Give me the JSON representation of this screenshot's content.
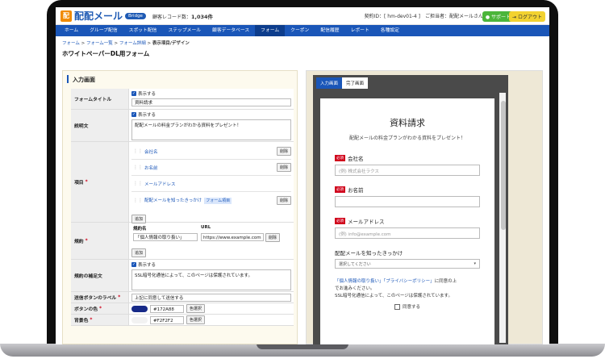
{
  "header": {
    "logo_mark": "配",
    "logo_text": "配配メール",
    "badge": "Bridge",
    "record_label": "顧客レコード数：",
    "record_count": "1,034件",
    "account": "契約ID：[ hm-dev01-4 ]　ご担当者：配配メールさん",
    "support": "サポート",
    "logout": "ログアウト"
  },
  "nav": [
    "ホーム",
    "グループ配信",
    "スポット配信",
    "ステップメール",
    "顧客データベース",
    "フォーム",
    "クーポン",
    "配信履歴",
    "レポート",
    "各種設定"
  ],
  "breadcrumb": {
    "a": "フォーム",
    "b": "フォーム一覧",
    "c": "フォーム詳細",
    "d": "表示項目/デザイン",
    "sep": " > "
  },
  "page_title": "ホワイトペーパーDL用フォーム",
  "left": {
    "section_title": "入力画面",
    "show_label": "表示する",
    "form_title_label": "フォームタイトル",
    "form_title_value": "資料請求",
    "desc_label": "説明文",
    "desc_value": "配配メールの料金プランがわかる資料をプレゼント！",
    "items_label": "項目",
    "items": [
      {
        "label": "会社名",
        "del": "削除"
      },
      {
        "label": "お名前",
        "del": "削除"
      },
      {
        "label": "メールアドレス",
        "del": ""
      },
      {
        "label": "配配メールを知ったきっかけ",
        "tag": "フォーム項目",
        "del": "削除"
      }
    ],
    "add": "追加",
    "terms_label": "規約",
    "terms_col1": "規約名",
    "terms_col2": "URL",
    "terms_name": "「個人情報の取り扱い」",
    "terms_url": "https://www.example.com",
    "terms_del": "削除",
    "supp_label": "規約の補足文",
    "supp_value": "SSL暗号化通信によって、このページは保護されています。",
    "submit_label": "送信ボタンのラベル",
    "submit_value": "上記に同意して送信する",
    "btncolor_label": "ボタンの色",
    "btncolor_value": "#172A88",
    "bg_label": "背景色",
    "bg_value": "#F2F2F2",
    "pick": "色選択"
  },
  "preview": {
    "tab1": "入力画面",
    "tab2": "完了画面",
    "title": "資料請求",
    "desc": "配配メールの料金プランがわかる資料をプレゼント！",
    "must": "必須",
    "f1": "会社名",
    "f1_ph": "(例) 株式会社ラクス",
    "f2": "お名前",
    "f3": "メールアドレス",
    "f3_ph": "(例) info@example.com",
    "f4": "配配メールを知ったきっかけ",
    "f4_sel": "選択してください",
    "note_link1": "「個人情報の取り扱い」",
    "note_link2": "「プライバシーポリシー」",
    "note_text1": "に同意の上",
    "note_text2": "でお進みください。",
    "note_text3": "SSL暗号化通信によって、このページは保護されています。",
    "agree": "同意する"
  },
  "colors": {
    "nav": "#1a56b8",
    "button_swatch": "#172A88",
    "bg_swatch": "#F2F2F2"
  }
}
